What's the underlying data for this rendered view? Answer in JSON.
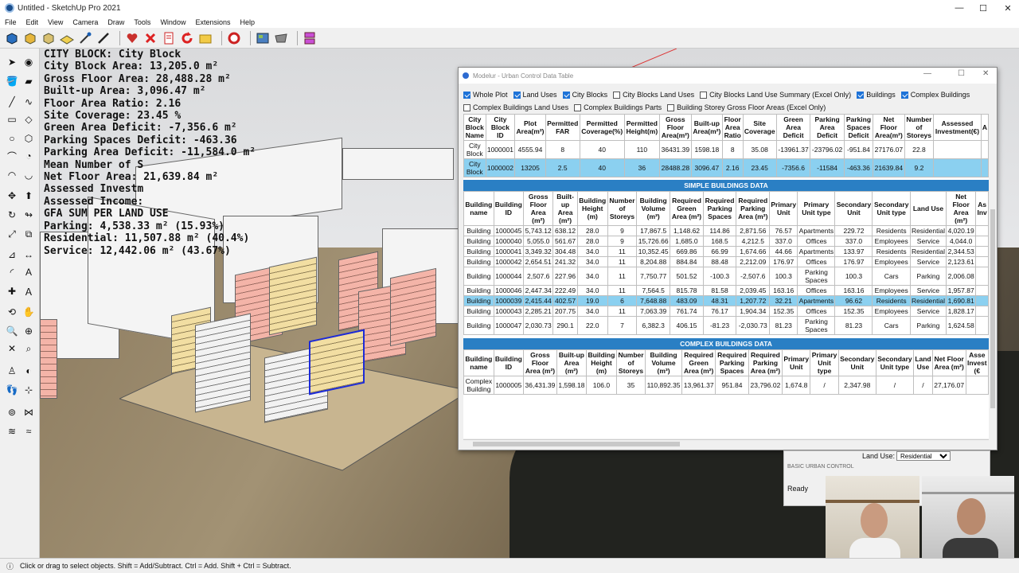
{
  "window": {
    "title": "Untitled - SketchUp Pro 2021",
    "min": "—",
    "max": "☐",
    "close": "✕"
  },
  "menu": [
    "File",
    "Edit",
    "View",
    "Camera",
    "Draw",
    "Tools",
    "Window",
    "Extensions",
    "Help"
  ],
  "stats": [
    "CITY BLOCK: City Block",
    "City Block Area: 13,205.0 m²",
    "Gross Floor Area: 28,488.28 m²",
    "Built-up Area: 3,096.47 m²",
    "Floor Area Ratio: 2.16",
    "Site Coverage: 23.45 %",
    "Green Area Deficit: -7,356.6 m²",
    "Parking Spaces Deficit: -463.36",
    "Parking Area Deficit: -11,584.0 m²",
    "Mean Number of S",
    "Net Floor Area: 21,639.84 m²",
    "Assessed Investm",
    "Assessed Income:",
    "GFA SUM PER LAND USE",
    "Parking: 4,538.33 m² (15.93%)",
    "Residential: 11,507.88 m² (40.4%)",
    "Service: 12,442.06 m² (43.67%)"
  ],
  "status": "Click or drag to select objects. Shift = Add/Subtract. Ctrl = Add. Shift + Ctrl = Subtract.",
  "dialog": {
    "title": "Modelur - Urban Control Data Table",
    "checks_row1": [
      {
        "label": "Whole Plot",
        "on": true
      },
      {
        "label": "Land Uses",
        "on": true
      },
      {
        "label": "City Blocks",
        "on": true
      },
      {
        "label": "City Blocks Land Uses",
        "on": false
      },
      {
        "label": "City Blocks Land Use Summary (Excel Only)",
        "on": false
      },
      {
        "label": "Buildings",
        "on": true
      },
      {
        "label": "Complex Buildings",
        "on": true
      }
    ],
    "checks_row2": [
      {
        "label": "Complex Buildings Land Uses",
        "on": false
      },
      {
        "label": "Complex Buildings Parts",
        "on": false
      },
      {
        "label": "Building Storey Gross Floor Areas (Excel Only)",
        "on": false
      }
    ],
    "cityblocks": {
      "headers": [
        "City Block Name",
        "City Block ID",
        "Plot Area(m²)",
        "Permitted FAR",
        "Permitted Coverage(%)",
        "Permitted Height(m)",
        "Gross Floor Area(m²)",
        "Built-up Area(m²)",
        "Floor Area Ratio",
        "Site Coverage",
        "Green Area Deficit",
        "Parking Area Deficit",
        "Parking Spaces Deficit",
        "Net Floor Area(m²)",
        "Number of Storeys",
        "Assessed Investment(€)",
        "A"
      ],
      "rows": [
        [
          "City Block",
          "1000001",
          "4555.94",
          "8",
          "40",
          "110",
          "36431.39",
          "1598.18",
          "8",
          "35.08",
          "-13961.37",
          "-23796.02",
          "-951.84",
          "27176.07",
          "22.8",
          "",
          ""
        ],
        [
          "City Block",
          "1000002",
          "13205",
          "2.5",
          "40",
          "36",
          "28488.28",
          "3096.47",
          "2.16",
          "23.45",
          "-7356.6",
          "-11584",
          "-463.36",
          "21639.84",
          "9.2",
          "",
          ""
        ]
      ]
    },
    "simple_title": "SIMPLE BUILDINGS DATA",
    "simple": {
      "headers": [
        "Building name",
        "Building ID",
        "Gross Floor Area (m²)",
        "Built-up Area (m²)",
        "Building Height (m)",
        "Number of Storeys",
        "Building Volume (m³)",
        "Required Green Area (m²)",
        "Required Parking Spaces",
        "Required Parking Area (m²)",
        "Primary Unit",
        "Primary Unit type",
        "Secondary Unit",
        "Secondary Unit type",
        "Land Use",
        "Net Floor Area (m²)",
        "As Inv"
      ],
      "rows": [
        [
          "Building",
          "1000045",
          "5,743.12",
          "638.12",
          "28.0",
          "9",
          "17,867.5",
          "1,148.62",
          "114.86",
          "2,871.56",
          "76.57",
          "Apartments",
          "229.72",
          "Residents",
          "Residential",
          "4,020.19",
          ""
        ],
        [
          "Building",
          "1000040",
          "5,055.0",
          "561.67",
          "28.0",
          "9",
          "15,726.66",
          "1,685.0",
          "168.5",
          "4,212.5",
          "337.0",
          "Offices",
          "337.0",
          "Employees",
          "Service",
          "4,044.0",
          ""
        ],
        [
          "Building",
          "1000041",
          "3,349.32",
          "304.48",
          "34.0",
          "11",
          "10,352.45",
          "669.86",
          "66.99",
          "1,674.66",
          "44.66",
          "Apartments",
          "133.97",
          "Residents",
          "Residential",
          "2,344.53",
          ""
        ],
        [
          "Building",
          "1000042",
          "2,654.51",
          "241.32",
          "34.0",
          "11",
          "8,204.88",
          "884.84",
          "88.48",
          "2,212.09",
          "176.97",
          "Offices",
          "176.97",
          "Employees",
          "Service",
          "2,123.61",
          ""
        ],
        [
          "Building",
          "1000044",
          "2,507.6",
          "227.96",
          "34.0",
          "11",
          "7,750.77",
          "501.52",
          "-100.3",
          "-2,507.6",
          "100.3",
          "Parking Spaces",
          "100.3",
          "Cars",
          "Parking",
          "2,006.08",
          ""
        ],
        [
          "Building",
          "1000046",
          "2,447.34",
          "222.49",
          "34.0",
          "11",
          "7,564.5",
          "815.78",
          "81.58",
          "2,039.45",
          "163.16",
          "Offices",
          "163.16",
          "Employees",
          "Service",
          "1,957.87",
          ""
        ],
        [
          "Building",
          "1000039",
          "2,415.44",
          "402.57",
          "19.0",
          "6",
          "7,648.88",
          "483.09",
          "48.31",
          "1,207.72",
          "32.21",
          "Apartments",
          "96.62",
          "Residents",
          "Residential",
          "1,690.81",
          ""
        ],
        [
          "Building",
          "1000043",
          "2,285.21",
          "207.75",
          "34.0",
          "11",
          "7,063.39",
          "761.74",
          "76.17",
          "1,904.34",
          "152.35",
          "Offices",
          "152.35",
          "Employees",
          "Service",
          "1,828.17",
          ""
        ],
        [
          "Building",
          "1000047",
          "2,030.73",
          "290.1",
          "22.0",
          "7",
          "6,382.3",
          "406.15",
          "-81.23",
          "-2,030.73",
          "81.23",
          "Parking Spaces",
          "81.23",
          "Cars",
          "Parking",
          "1,624.58",
          ""
        ]
      ],
      "selected_index": 6
    },
    "complex_title": "COMPLEX BUILDINGS DATA",
    "complex": {
      "headers": [
        "Building name",
        "Building ID",
        "Gross Floor Area (m²)",
        "Built-up Area (m²)",
        "Building Height (m)",
        "Number of Storeys",
        "Building Volume (m³)",
        "Required Green Area (m²)",
        "Required Parking Spaces",
        "Required Parking Area (m²)",
        "Primary Unit",
        "Primary Unit type",
        "Secondary Unit",
        "Secondary Unit type",
        "Land Use",
        "Net Floor Area (m²)",
        "Asse Invest (€"
      ],
      "rows": [
        [
          "Complex Building",
          "1000005",
          "36,431.39",
          "1,598.18",
          "106.0",
          "35",
          "110,892.35",
          "13,961.37",
          "951.84",
          "23,796.02",
          "1,674.8",
          "/",
          "2,347.98",
          "/",
          "/",
          "27,176.07",
          ""
        ]
      ]
    }
  },
  "panel": {
    "landuse_label": "Land Use:",
    "landuse_value": "Residential",
    "section": "BASIC URBAN CONTROL",
    "ready": "Ready"
  }
}
